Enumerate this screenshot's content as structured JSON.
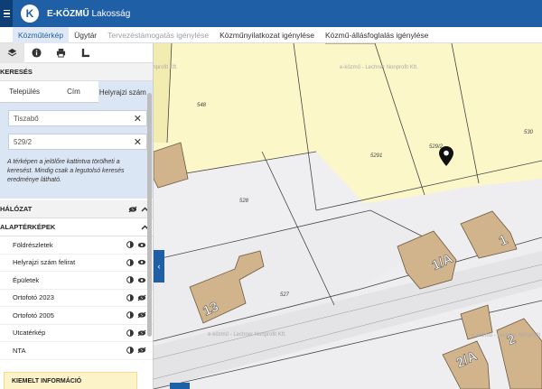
{
  "header": {
    "app_name": "E-KÖZMŰ",
    "app_sub": "Lakosság",
    "logo_letter": "K"
  },
  "nav": {
    "tabs": [
      "Közműtérkép",
      "Ügytár",
      "Tervezéstámogatás igénylése",
      "Közműnyilatkozat igénylése",
      "Közmű-állásfoglalás igénylése"
    ]
  },
  "search": {
    "title": "KERESÉS",
    "tabs": [
      "Település",
      "Cím",
      "Helyrajzi szám"
    ],
    "settlement_value": "Tiszabő",
    "parcel_value": "529/2",
    "hint": "A térképen a jelölőre kattintva törölheti a keresést. Mindig csak a legutolsó keresés eredménye látható."
  },
  "network": {
    "title": "HÁLÓZAT"
  },
  "basemaps": {
    "title": "ALAPTÉRKÉPEK",
    "items": [
      "Földrészletek",
      "Helyrajzi szám felirat",
      "Épületek",
      "Ortofotó 2023",
      "Ortofotó 2005",
      "Utcatérkép",
      "NTA"
    ]
  },
  "highlight": {
    "title": "KIEMELT INFORMÁCIÓ"
  },
  "map": {
    "parcel_labels": [
      "548",
      "5291",
      "529/2",
      "530",
      "528",
      "527"
    ],
    "building_labels": [
      "13",
      "1/A",
      "1",
      "2/A",
      "2"
    ],
    "watermark": "e-közmű - Lechner Nonprofit Kft."
  },
  "colors": {
    "brand": "#1f5fa6",
    "parcel_fill": "#fbf7c8",
    "building": "#d2b48c"
  }
}
